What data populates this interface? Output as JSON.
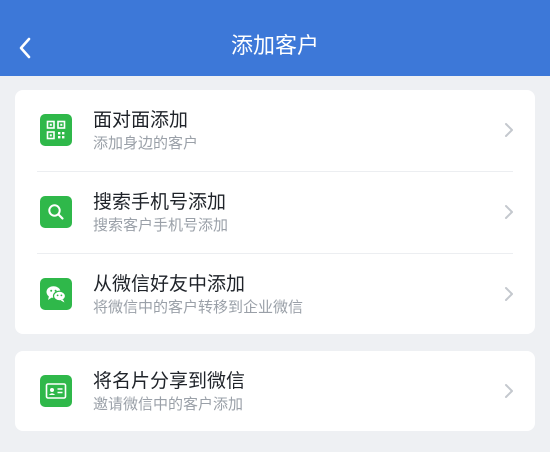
{
  "header": {
    "title": "添加客户",
    "back_icon": "back-arrow-icon",
    "background": "#3d78d8"
  },
  "options": [
    {
      "title": "面对面添加",
      "subtitle": "添加身边的客户",
      "icon": "qr-code-icon"
    },
    {
      "title": "搜索手机号添加",
      "subtitle": "搜索客户手机号添加",
      "icon": "search-icon"
    },
    {
      "title": "从微信好友中添加",
      "subtitle": "将微信中的客户转移到企业微信",
      "icon": "wechat-icon"
    }
  ],
  "share": {
    "title": "将名片分享到微信",
    "subtitle": "邀请微信中的客户添加",
    "icon": "business-card-icon"
  },
  "colors": {
    "accent_green": "#2fb84a",
    "page_bg": "#eef0f3"
  }
}
